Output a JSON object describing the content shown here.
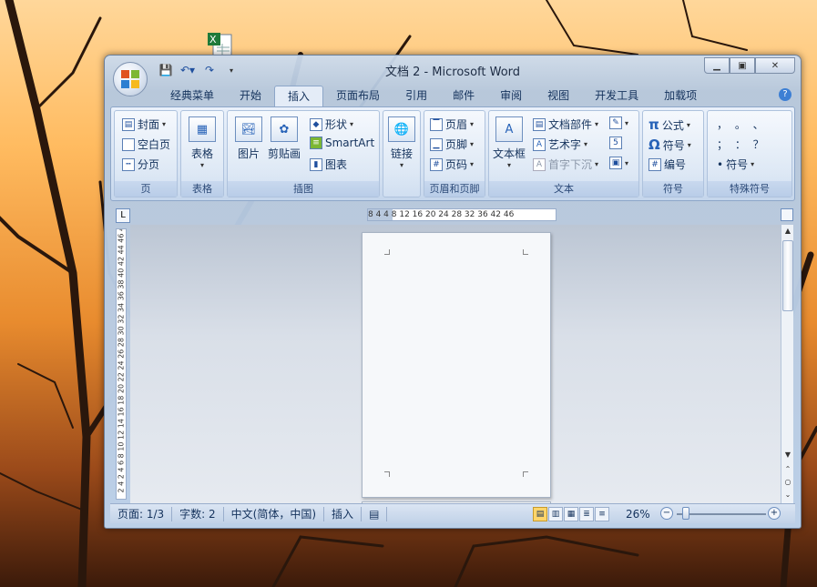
{
  "window": {
    "title": "文档 2 - Microsoft Word"
  },
  "qat": {
    "save": "save-icon",
    "undo": "undo-icon",
    "redo": "redo-icon"
  },
  "tabs": [
    "经典菜单",
    "开始",
    "插入",
    "页面布局",
    "引用",
    "邮件",
    "审阅",
    "视图",
    "开发工具",
    "加载项"
  ],
  "active_tab": "插入",
  "help": "?",
  "ribbon": {
    "page": {
      "label": "页",
      "items": [
        "封面",
        "空白页",
        "分页"
      ]
    },
    "table": {
      "label": "表格",
      "button": "表格"
    },
    "illustrations": {
      "label": "插图",
      "picture": "图片",
      "clipart": "剪贴画",
      "shapes": "形状",
      "smartart": "SmartArt",
      "chart": "图表"
    },
    "links": {
      "button": "链接"
    },
    "header_footer": {
      "label": "页眉和页脚",
      "header": "页眉",
      "footer": "页脚",
      "page_number": "页码"
    },
    "text": {
      "label": "文本",
      "textbox": "文本框",
      "quickparts": "文档部件",
      "wordart": "艺术字",
      "dropcap": "首字下沉"
    },
    "symbols": {
      "label": "符号",
      "equation": "公式",
      "symbol": "符号",
      "numbering": "编号",
      "pi": "π",
      "omega": "Ω"
    },
    "special": {
      "label": "特殊符号",
      "row1": "，  。  、",
      "row2": "；  ：  ？",
      "symbol": "符号"
    }
  },
  "ruler": {
    "horizontal": "8  4       4   8  12  16  20  24  28  32  36  42  46",
    "vertical": "2  4     2  4  6  8  10 12 14 16 18 20 22 24 26 28 30 32 34 36 38 40 42 44 46 48"
  },
  "status": {
    "page": "页面: 1/3",
    "words": "字数: 2",
    "language": "中文(简体，中国)",
    "mode": "插入",
    "zoom": "26%"
  }
}
